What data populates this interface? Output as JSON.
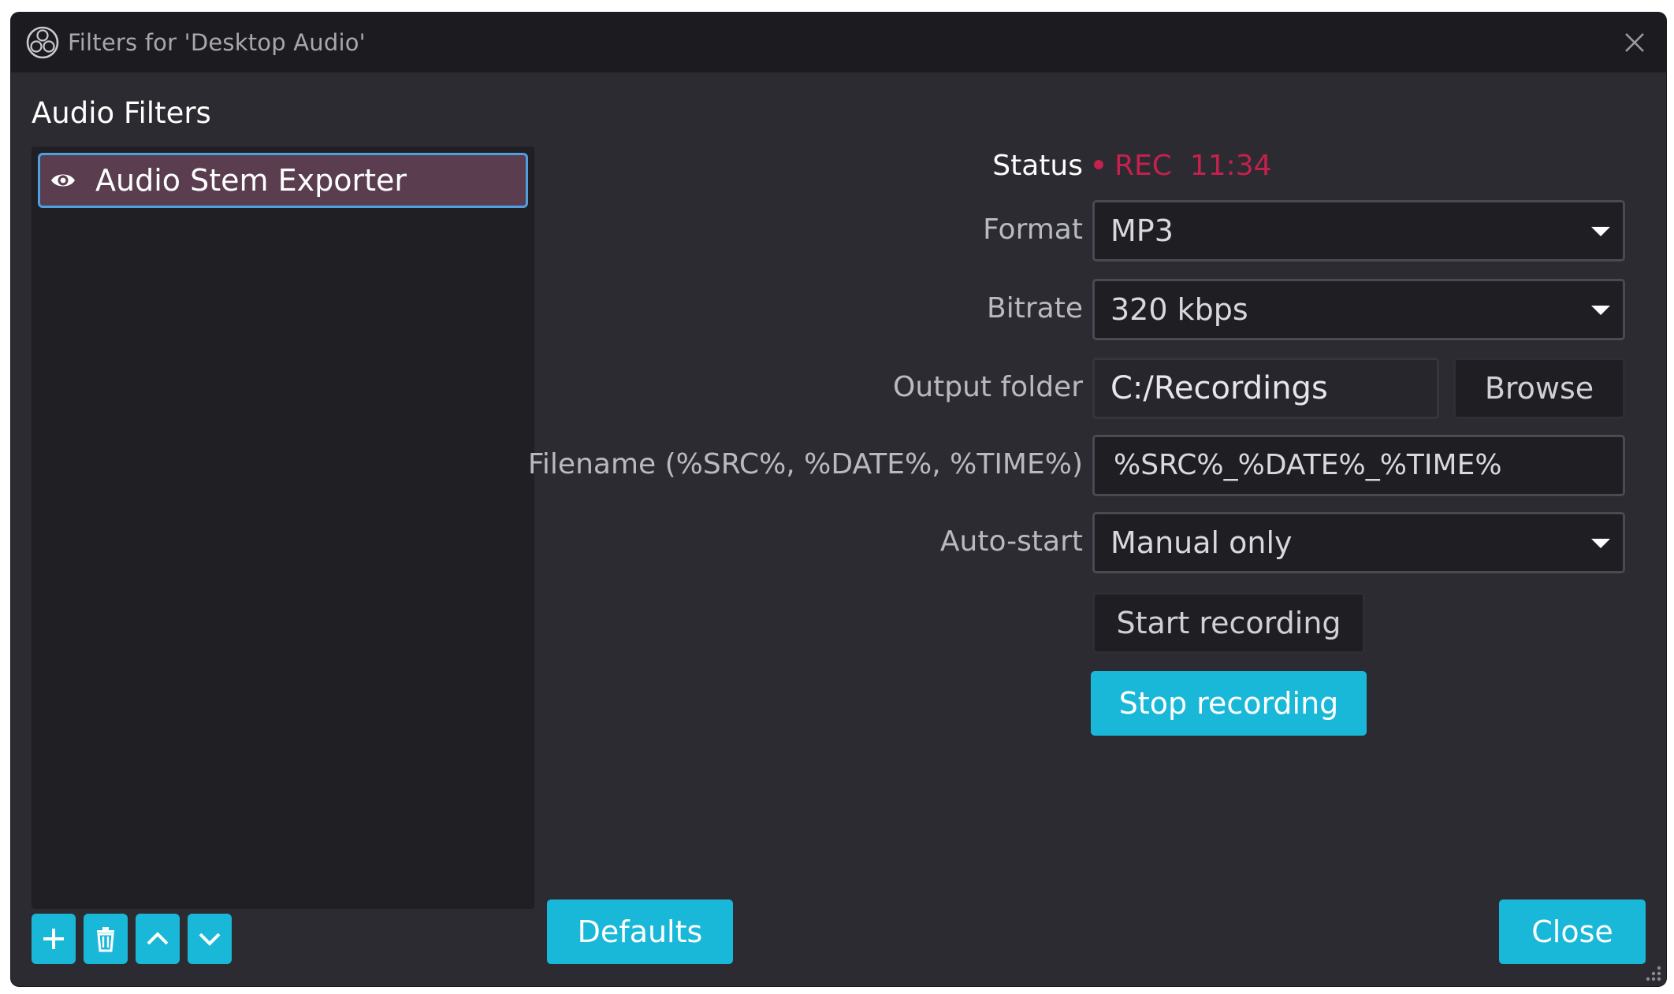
{
  "window": {
    "title": "Filters for 'Desktop Audio'"
  },
  "sidebar": {
    "heading": "Audio Filters",
    "filters": [
      {
        "name": "Audio Stem Exporter",
        "visible": true,
        "selected": true
      }
    ],
    "tools": [
      "add-icon",
      "trash-icon",
      "chevron-up-icon",
      "chevron-down-icon"
    ]
  },
  "form": {
    "status": {
      "label": "Status",
      "value": "REC  11:34"
    },
    "format": {
      "label": "Format",
      "value": "MP3"
    },
    "bitrate": {
      "label": "Bitrate",
      "value": "320 kbps"
    },
    "output_folder": {
      "label": "Output folder",
      "value": "C:/Recordings",
      "browse_label": "Browse"
    },
    "filename": {
      "label": "Filename  (%SRC%, %DATE%, %TIME%)",
      "value": "%SRC%_%DATE%_%TIME%"
    },
    "auto_start": {
      "label": "Auto-start",
      "value": "Manual only"
    },
    "start_label": "Start recording",
    "stop_label": "Stop recording"
  },
  "footer": {
    "defaults_label": "Defaults",
    "close_label": "Close"
  },
  "colors": {
    "accent": "#1ab8d8",
    "rec": "#c4214d",
    "selected_item": "#5a3e50",
    "background": "#2b2b31"
  }
}
